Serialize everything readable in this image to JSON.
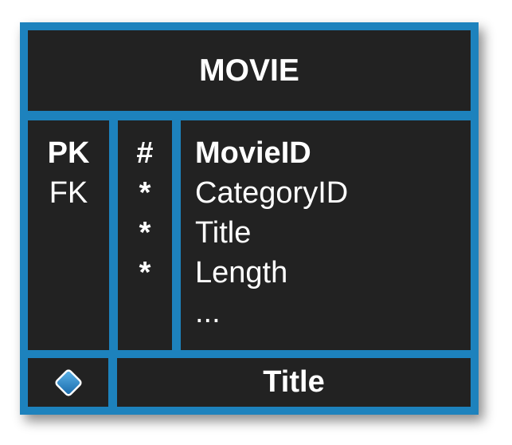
{
  "entity": {
    "name": "MOVIE",
    "keys": [
      "PK",
      "FK",
      "",
      "",
      ""
    ],
    "marks": [
      "#",
      "*",
      "*",
      "*",
      ""
    ],
    "attributes": [
      "MovieID",
      "CategoryID",
      "Title",
      "Length",
      "..."
    ],
    "index_name": "Title",
    "index_icon": "diamond-icon"
  },
  "colors": {
    "border": "#1d82bd",
    "cell_background": "#222222",
    "text": "#ffffff",
    "diamond": "#2e8fd1"
  }
}
